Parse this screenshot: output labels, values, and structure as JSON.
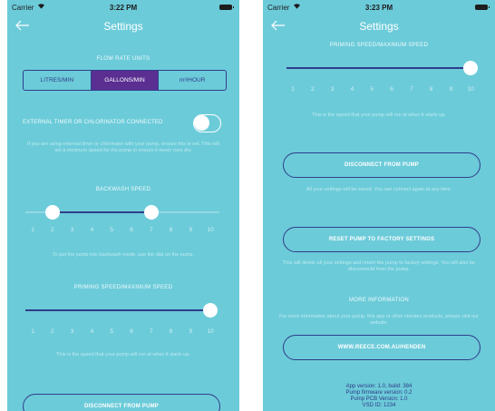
{
  "colors": {
    "background": "#6ccbd9",
    "accent": "#2f3d8a",
    "selected": "#5a2f91",
    "white": "#ffffff"
  },
  "left": {
    "status": {
      "carrier": "Carrier",
      "time": "3:22 PM"
    },
    "nav": {
      "title": "Settings"
    },
    "flow_rate": {
      "label": "FLOW RATE UNITS",
      "options": [
        "LITRES/MIN",
        "GALLONS/MIN",
        "m³/HOUR"
      ],
      "selected": "GALLONS/MIN"
    },
    "external_timer": {
      "label": "EXTERNAL TIMER OR CHLORINATOR CONNECTED",
      "on": false,
      "help": "If you are using external timer or chlorinator with your pump, ensure this is set. This will set a minimum speed for the pump to ensure it never runs dry."
    },
    "backwash": {
      "label": "BACKWASH SPEED",
      "ticks": [
        "1",
        "2",
        "3",
        "4",
        "5",
        "6",
        "7",
        "8",
        "9",
        "10"
      ],
      "low_value": 2,
      "high_value": 7,
      "help": "To put the pump into backwash mode, use the dial on the pump."
    },
    "priming": {
      "label": "PRIMING SPEED/MAXIMUM SPEED",
      "ticks": [
        "1",
        "2",
        "3",
        "4",
        "5",
        "6",
        "7",
        "8",
        "9",
        "10"
      ],
      "value": 10,
      "help": "This is the speed that your pump will run at when it starts up."
    },
    "disconnect_label": "DISCONNECT FROM PUMP"
  },
  "right": {
    "status": {
      "carrier": "Carrier",
      "time": "3:23 PM"
    },
    "nav": {
      "title": "Settings"
    },
    "priming": {
      "label": "PRIMING SPEED/MAXIMUM SPEED",
      "ticks": [
        "1",
        "2",
        "3",
        "4",
        "5",
        "6",
        "7",
        "8",
        "9",
        "10"
      ],
      "value": 10,
      "help": "This is the speed that your pump will run at when it starts up."
    },
    "disconnect": {
      "label": "DISCONNECT FROM PUMP",
      "help": "All your settings will be saved. You can connect again at any time."
    },
    "reset": {
      "label": "RESET PUMP TO FACTORY SETTINGS",
      "help": "This will delete all your settings and return the pump to factory settings. You will also be disconnectd from the pump."
    },
    "more_info": {
      "label": "MORE INFORMATION",
      "help": "For more information about your pump, this app or other Henden products, please visit our website.",
      "link": "WWW.REECE.COM.AU/HENDEN"
    },
    "version": {
      "app": "App version: 1.0, build: 384",
      "firmware": "Pump firmware version: 0.2",
      "pcb": "Pump PCB Version: 1.0",
      "vsd": "VSD ID: 1234"
    }
  }
}
